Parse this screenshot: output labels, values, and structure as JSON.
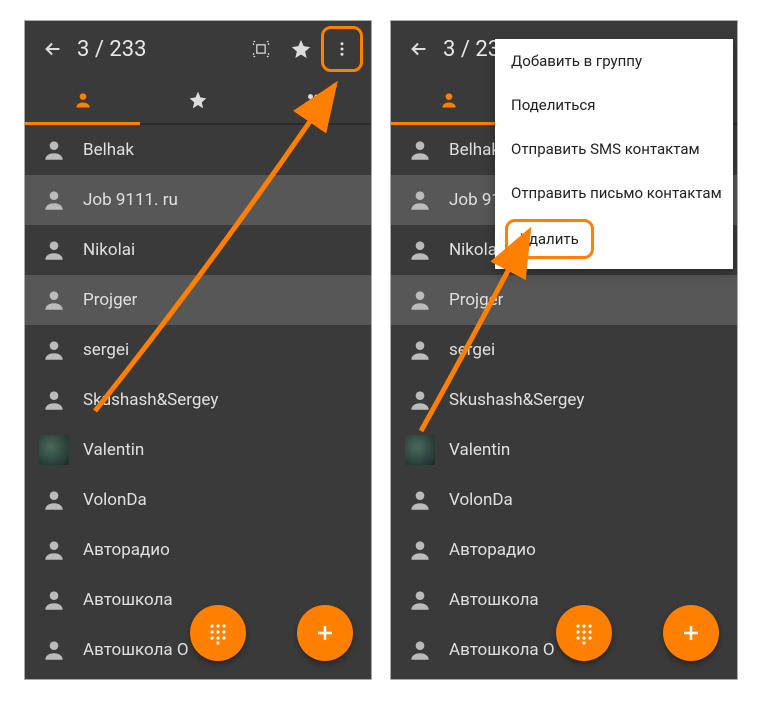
{
  "colors": {
    "accent": "#ff7f00",
    "bg": "#3a3a3a",
    "selected": "#575757"
  },
  "topbar": {
    "title": "3 / 233",
    "icons": {
      "back": "arrow-left",
      "select_all": "select-all",
      "star": "star",
      "more": "more-vert"
    }
  },
  "tabs": [
    {
      "id": "contacts",
      "icon": "person",
      "active": true
    },
    {
      "id": "favorites",
      "icon": "star",
      "active": false
    },
    {
      "id": "groups",
      "icon": "group-add",
      "active": false
    }
  ],
  "contacts": [
    {
      "name": "Belhak",
      "selected": false,
      "avatar": "person"
    },
    {
      "name": "Job 9111. ru",
      "selected": true,
      "avatar": "person"
    },
    {
      "name": "Nikolai",
      "selected": false,
      "avatar": "person"
    },
    {
      "name": "Projger",
      "selected": true,
      "avatar": "person"
    },
    {
      "name": "sergei",
      "selected": false,
      "avatar": "person"
    },
    {
      "name": "Skushash&Sergey",
      "selected": false,
      "avatar": "person"
    },
    {
      "name": "Valentin",
      "selected": false,
      "avatar": "image"
    },
    {
      "name": "VolonDa",
      "selected": false,
      "avatar": "person"
    },
    {
      "name": "Авторадио",
      "selected": false,
      "avatar": "person"
    },
    {
      "name": "Автошкола",
      "selected": false,
      "avatar": "person"
    },
    {
      "name": "Автошкола О",
      "selected": false,
      "avatar": "person"
    }
  ],
  "fab": {
    "dial": "dialpad",
    "add": "plus"
  },
  "menu": {
    "items": [
      "Добавить в группу",
      "Поделиться",
      "Отправить SMS контактам",
      "Отправить письмо контактам"
    ],
    "highlighted": "Удалить"
  }
}
